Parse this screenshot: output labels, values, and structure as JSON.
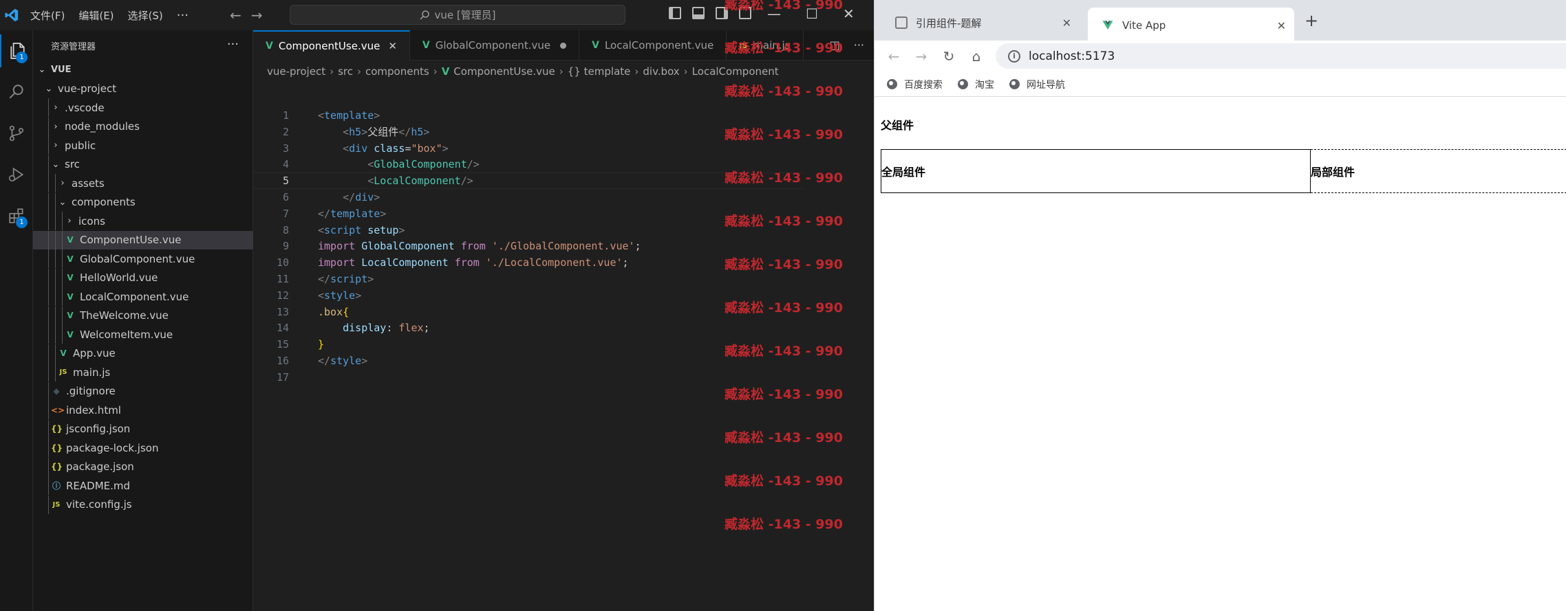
{
  "vscode": {
    "menu": [
      "文件(F)",
      "编辑(E)",
      "选择(S)"
    ],
    "menu_more": "···",
    "search_text": "vue [管理员]",
    "explorer_title": "资源管理器",
    "explorer_more": "···",
    "activity_badges": {
      "explorer": "1",
      "extensions": "1"
    },
    "tree": [
      {
        "label": "VUE",
        "type": "root-open",
        "depth": 0
      },
      {
        "label": "vue-project",
        "type": "folder-open",
        "depth": 1
      },
      {
        "label": ".vscode",
        "type": "folder",
        "depth": 2
      },
      {
        "label": "node_modules",
        "type": "folder",
        "depth": 2
      },
      {
        "label": "public",
        "type": "folder",
        "depth": 2
      },
      {
        "label": "src",
        "type": "folder-open",
        "depth": 2
      },
      {
        "label": "assets",
        "type": "folder",
        "depth": 3
      },
      {
        "label": "components",
        "type": "folder-open",
        "depth": 3
      },
      {
        "label": "icons",
        "type": "folder",
        "depth": 4
      },
      {
        "label": "ComponentUse.vue",
        "type": "vue",
        "depth": 4,
        "selected": true
      },
      {
        "label": "GlobalComponent.vue",
        "type": "vue",
        "depth": 4
      },
      {
        "label": "HelloWorld.vue",
        "type": "vue",
        "depth": 4
      },
      {
        "label": "LocalComponent.vue",
        "type": "vue",
        "depth": 4
      },
      {
        "label": "TheWelcome.vue",
        "type": "vue",
        "depth": 4
      },
      {
        "label": "WelcomeItem.vue",
        "type": "vue",
        "depth": 4
      },
      {
        "label": "App.vue",
        "type": "vue",
        "depth": 3
      },
      {
        "label": "main.js",
        "type": "js",
        "depth": 3
      },
      {
        "label": ".gitignore",
        "type": "git",
        "depth": 2
      },
      {
        "label": "index.html",
        "type": "html",
        "depth": 2
      },
      {
        "label": "jsconfig.json",
        "type": "json",
        "depth": 2
      },
      {
        "label": "package-lock.json",
        "type": "json",
        "depth": 2
      },
      {
        "label": "package.json",
        "type": "json",
        "depth": 2
      },
      {
        "label": "README.md",
        "type": "md",
        "depth": 2
      },
      {
        "label": "vite.config.js",
        "type": "js",
        "depth": 2
      }
    ],
    "tabs": [
      {
        "label": "ComponentUse.vue",
        "active": true,
        "close": "✕",
        "icon": "V"
      },
      {
        "label": "GlobalComponent.vue",
        "modified": true,
        "icon": "V"
      },
      {
        "label": "LocalComponent.vue",
        "icon": "V"
      },
      {
        "label": "main.js",
        "icon": "JS"
      }
    ],
    "breadcrumb": [
      "vue-project",
      "src",
      "components",
      "ComponentUse.vue",
      "{} template",
      "div.box",
      "LocalComponent"
    ],
    "code_lines": [
      {
        "n": "1",
        "tokens": [
          [
            "t-tag",
            "<"
          ],
          [
            "t-name",
            "template"
          ],
          [
            "t-tag",
            ">"
          ]
        ]
      },
      {
        "n": "2",
        "tokens": [
          [
            "t-txt",
            "    "
          ],
          [
            "t-tag",
            "<"
          ],
          [
            "t-name",
            "h5"
          ],
          [
            "t-tag",
            ">"
          ],
          [
            "t-txt",
            "父组件"
          ],
          [
            "t-tag",
            "</"
          ],
          [
            "t-name",
            "h5"
          ],
          [
            "t-tag",
            ">"
          ]
        ]
      },
      {
        "n": "3",
        "tokens": [
          [
            "t-txt",
            "    "
          ],
          [
            "t-tag",
            "<"
          ],
          [
            "t-name",
            "div"
          ],
          [
            "t-txt",
            " "
          ],
          [
            "t-attr",
            "class"
          ],
          [
            "t-txt",
            "="
          ],
          [
            "t-str",
            "\"box\""
          ],
          [
            "t-tag",
            ">"
          ]
        ]
      },
      {
        "n": "4",
        "tokens": [
          [
            "t-txt",
            "        "
          ],
          [
            "t-tag",
            "<"
          ],
          [
            "t-comp",
            "GlobalComponent"
          ],
          [
            "t-tag",
            "/>"
          ]
        ]
      },
      {
        "n": "5",
        "tokens": [
          [
            "t-txt",
            "        "
          ],
          [
            "t-tag",
            "<"
          ],
          [
            "t-comp",
            "LocalComponent"
          ],
          [
            "t-tag",
            "/>"
          ]
        ],
        "current": true
      },
      {
        "n": "6",
        "tokens": [
          [
            "t-txt",
            "    "
          ],
          [
            "t-tag",
            "</"
          ],
          [
            "t-name",
            "div"
          ],
          [
            "t-tag",
            ">"
          ]
        ]
      },
      {
        "n": "7",
        "tokens": [
          [
            "t-tag",
            "</"
          ],
          [
            "t-name",
            "template"
          ],
          [
            "t-tag",
            ">"
          ]
        ]
      },
      {
        "n": "8",
        "tokens": [
          [
            "t-tag",
            "<"
          ],
          [
            "t-name",
            "script"
          ],
          [
            "t-txt",
            " "
          ],
          [
            "t-attr",
            "setup"
          ],
          [
            "t-tag",
            ">"
          ]
        ]
      },
      {
        "n": "9",
        "tokens": [
          [
            "t-kw",
            "import"
          ],
          [
            "t-txt",
            " "
          ],
          [
            "t-var",
            "GlobalComponent"
          ],
          [
            "t-txt",
            " "
          ],
          [
            "t-kw",
            "from"
          ],
          [
            "t-txt",
            " "
          ],
          [
            "t-str",
            "'./GlobalComponent.vue'"
          ],
          [
            "t-txt",
            ";"
          ]
        ]
      },
      {
        "n": "10",
        "tokens": [
          [
            "t-kw",
            "import"
          ],
          [
            "t-txt",
            " "
          ],
          [
            "t-var",
            "LocalComponent"
          ],
          [
            "t-txt",
            " "
          ],
          [
            "t-kw",
            "from"
          ],
          [
            "t-txt",
            " "
          ],
          [
            "t-str",
            "'./LocalComponent.vue'"
          ],
          [
            "t-txt",
            ";"
          ]
        ]
      },
      {
        "n": "11",
        "tokens": [
          [
            "t-tag",
            "</"
          ],
          [
            "t-name",
            "script"
          ],
          [
            "t-tag",
            ">"
          ]
        ]
      },
      {
        "n": "12",
        "tokens": [
          [
            "t-tag",
            "<"
          ],
          [
            "t-name",
            "style"
          ],
          [
            "t-tag",
            ">"
          ]
        ]
      },
      {
        "n": "13",
        "tokens": [
          [
            "t-sel",
            ".box"
          ],
          [
            "t-brace",
            "{"
          ]
        ]
      },
      {
        "n": "14",
        "tokens": [
          [
            "t-txt",
            "    "
          ],
          [
            "t-var",
            "display"
          ],
          [
            "t-txt",
            ": "
          ],
          [
            "t-str",
            "flex"
          ],
          [
            "t-txt",
            ";"
          ]
        ]
      },
      {
        "n": "15",
        "tokens": [
          [
            "t-brace",
            "}"
          ]
        ]
      },
      {
        "n": "16",
        "tokens": [
          [
            "t-tag",
            "</"
          ],
          [
            "t-name",
            "style"
          ],
          [
            "t-tag",
            ">"
          ]
        ]
      },
      {
        "n": "17",
        "tokens": []
      }
    ],
    "watermark": "臧淼松 -143 - 990",
    "watermark_count": 13
  },
  "browser": {
    "tabs": [
      {
        "label": "引用组件-题解",
        "close": "✕"
      },
      {
        "label": "Vite App",
        "close": "✕",
        "active": true
      }
    ],
    "new_tab": "+",
    "url": "localhost:5173",
    "bookmarks": [
      "百度搜索",
      "淘宝",
      "网址导航"
    ],
    "page": {
      "parent_heading": "父组件",
      "global_component": "全局组件",
      "local_component": "局部组件"
    }
  },
  "colors": {
    "vscode_bg": "#1f1f1f",
    "accent": "#0078d4",
    "vue_green": "#41b883",
    "watermark_red": "#c0282e"
  }
}
